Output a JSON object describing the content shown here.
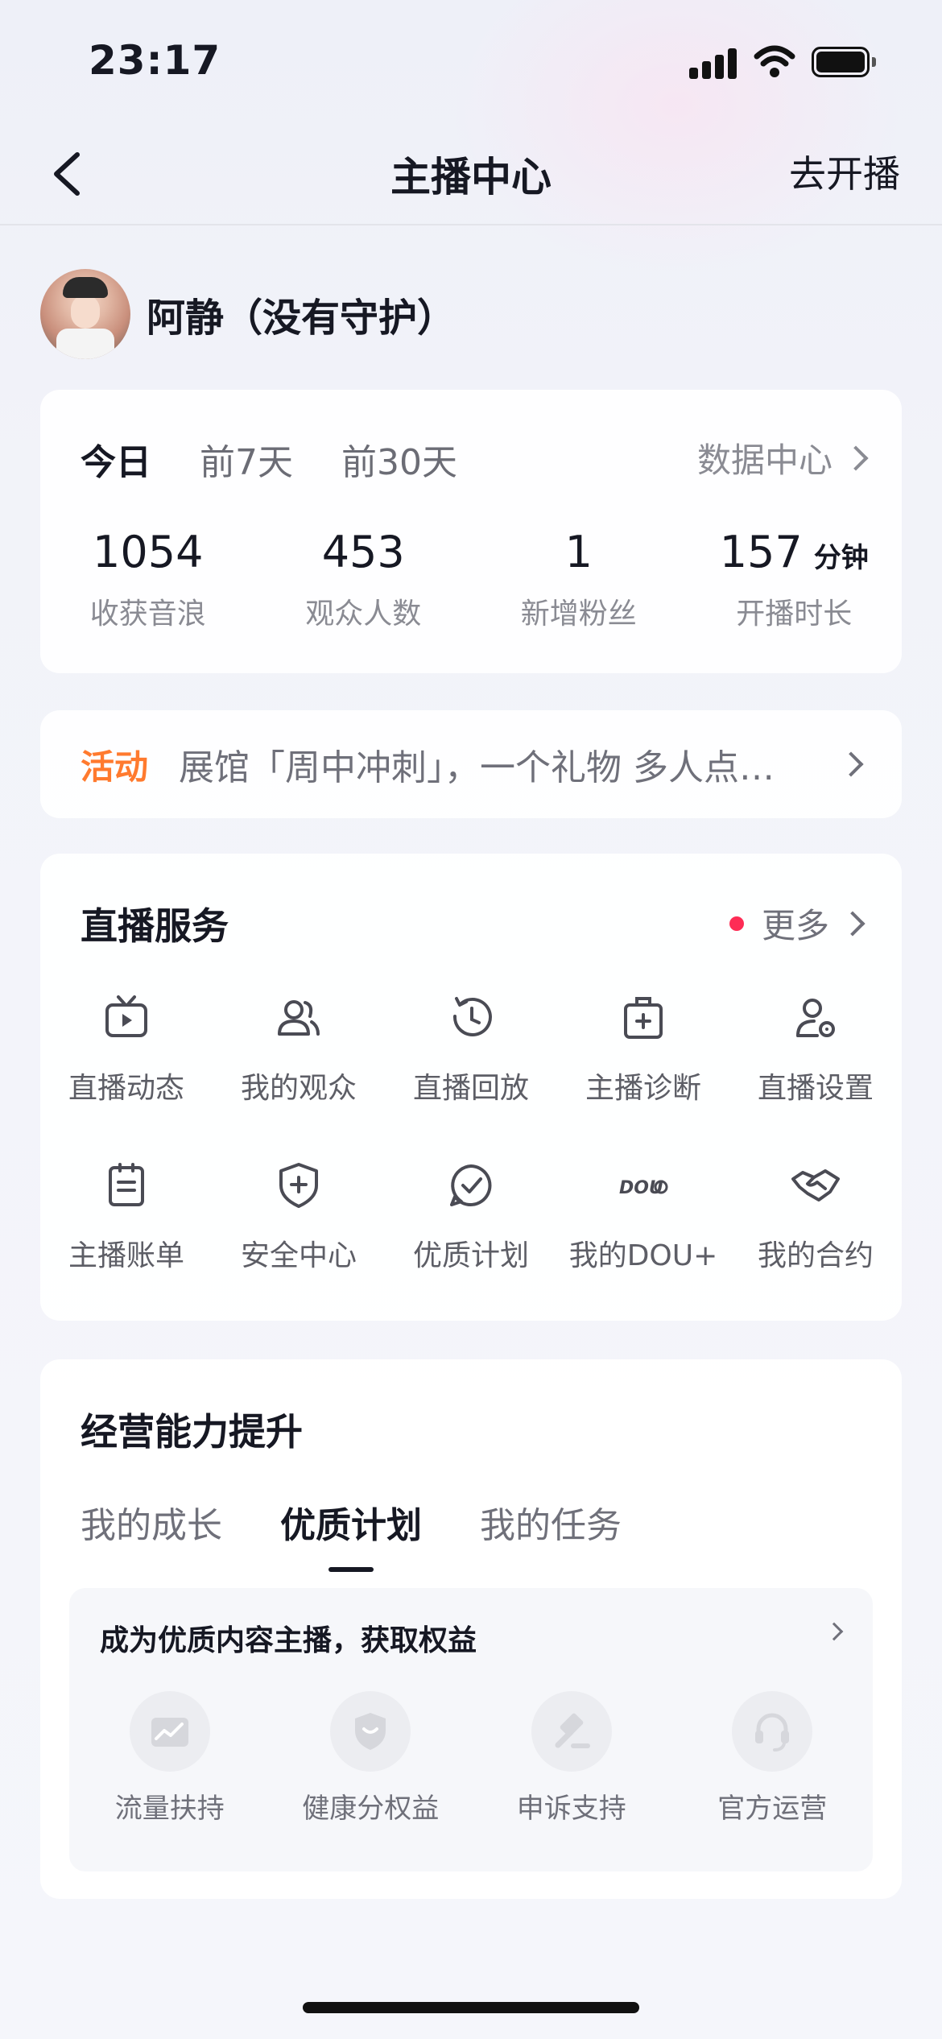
{
  "status_bar": {
    "time": "23:17"
  },
  "nav": {
    "title": "主播中心",
    "action": "去开播"
  },
  "profile": {
    "name": "阿静（没有守护）"
  },
  "stats": {
    "tabs": [
      "今日",
      "前7天",
      "前30天"
    ],
    "active_tab": "今日",
    "data_center": "数据中心",
    "items": [
      {
        "value": "1054",
        "unit": "",
        "label": "收获音浪"
      },
      {
        "value": "453",
        "unit": "",
        "label": "观众人数"
      },
      {
        "value": "1",
        "unit": "",
        "label": "新增粉丝"
      },
      {
        "value": "157",
        "unit": "分钟",
        "label": "开播时长"
      }
    ]
  },
  "activity": {
    "tag": "活动",
    "text": "展馆「周中冲刺」，一个礼物 多人点…"
  },
  "services": {
    "title": "直播服务",
    "more": "更多",
    "items": [
      {
        "label": "直播动态",
        "icon": "tv-icon"
      },
      {
        "label": "我的观众",
        "icon": "audience-icon"
      },
      {
        "label": "直播回放",
        "icon": "replay-clock-icon"
      },
      {
        "label": "主播诊断",
        "icon": "medical-kit-icon"
      },
      {
        "label": "直播设置",
        "icon": "user-settings-icon"
      },
      {
        "label": "主播账单",
        "icon": "bill-icon"
      },
      {
        "label": "安全中心",
        "icon": "shield-plus-icon"
      },
      {
        "label": "优质计划",
        "icon": "check-chat-icon"
      },
      {
        "label": "我的DOU+",
        "icon": "dou-plus-icon"
      },
      {
        "label": "我的合约",
        "icon": "handshake-icon"
      }
    ]
  },
  "business": {
    "title": "经营能力提升",
    "tabs": [
      "我的成长",
      "优质计划",
      "我的任务"
    ],
    "active_tab": "优质计划",
    "panel_title": "成为优质内容主播，获取权益",
    "benefits": [
      {
        "label": "流量扶持",
        "icon": "traffic-chart-icon"
      },
      {
        "label": "健康分权益",
        "icon": "shield-icon"
      },
      {
        "label": "申诉支持",
        "icon": "gavel-icon"
      },
      {
        "label": "官方运营",
        "icon": "headset-icon"
      }
    ]
  },
  "colors": {
    "activity_tag": "#ff7a2e",
    "dot": "#fe2c55",
    "text_primary": "#161823",
    "text_secondary": "#8a8b93"
  }
}
